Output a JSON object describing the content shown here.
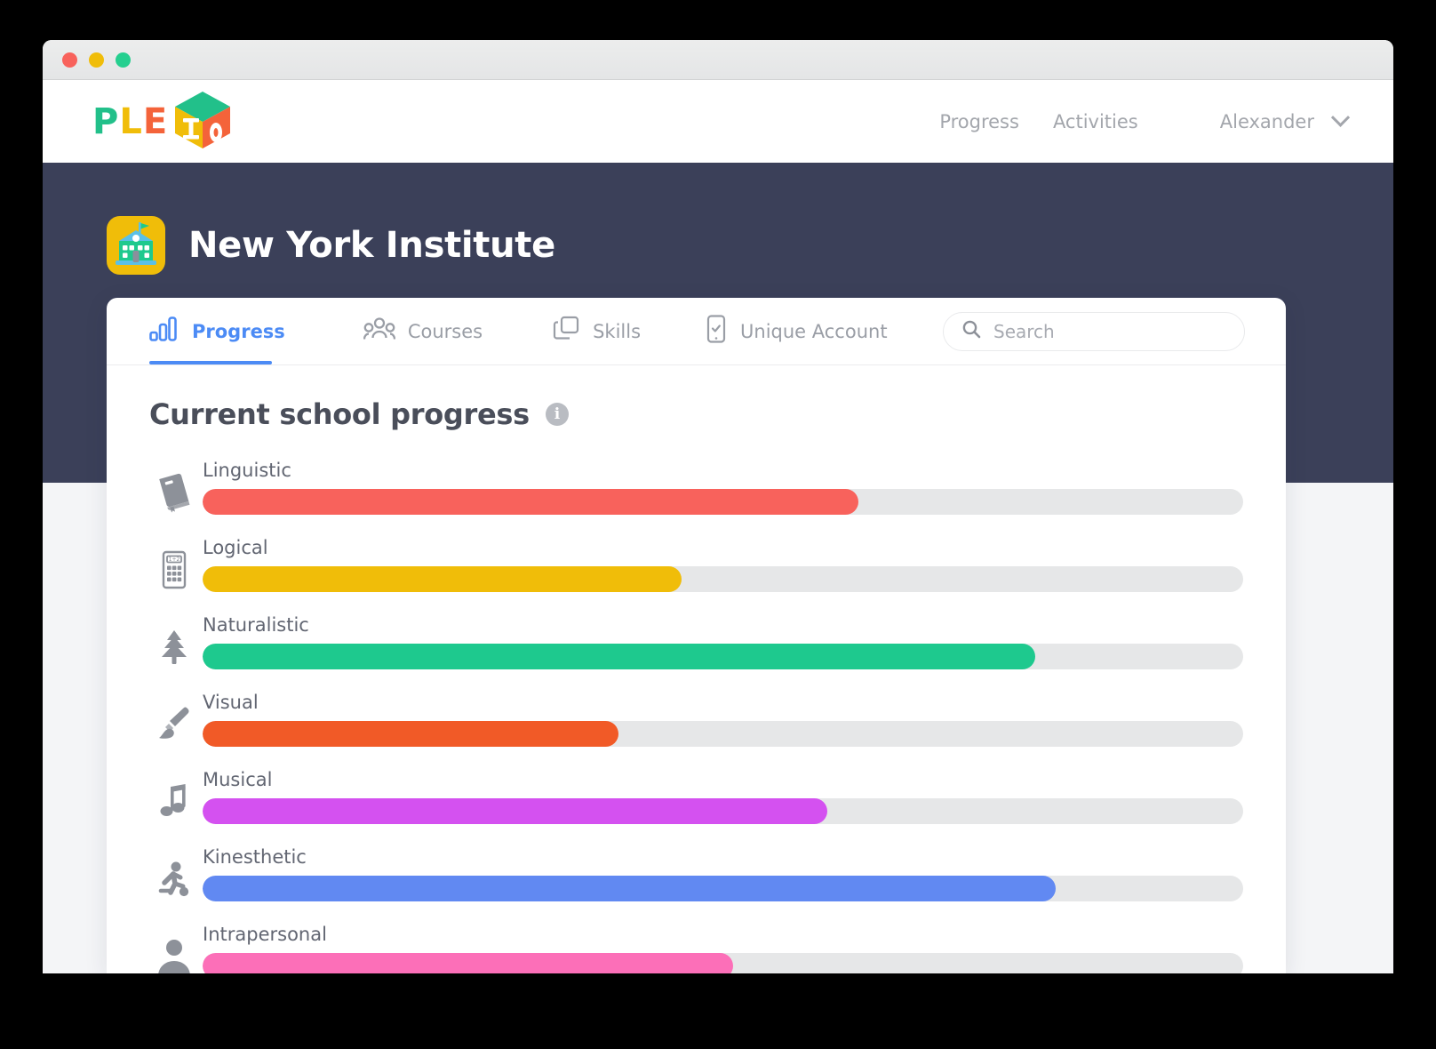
{
  "window": {
    "traffic_lights": [
      "close",
      "minimize",
      "maximize"
    ]
  },
  "brand": {
    "name": "PLEIO",
    "part1": "PLE",
    "part2": "I",
    "part3": "O",
    "colors": {
      "green": "#22c08a",
      "yellow": "#f0bd09",
      "orange": "#f4633a"
    }
  },
  "topnav": {
    "links": [
      {
        "label": "Progress",
        "name": "nav-link-progress"
      },
      {
        "label": "Activities",
        "name": "nav-link-activities"
      }
    ],
    "user": {
      "label": "Alexander",
      "caret": "chevron-down-icon"
    }
  },
  "header": {
    "icon": "school-icon",
    "title": "New York Institute"
  },
  "tabs": [
    {
      "label": "Progress",
      "icon": "bar-chart-icon",
      "active": true
    },
    {
      "label": "Courses",
      "icon": "people-group-icon",
      "active": false
    },
    {
      "label": "Skills",
      "icon": "layers-copy-icon",
      "active": false
    },
    {
      "label": "Unique Account",
      "icon": "mobile-check-icon",
      "active": false
    }
  ],
  "search": {
    "placeholder": "Search",
    "value": "",
    "icon": "search-icon"
  },
  "section": {
    "title": "Current school progress",
    "info_icon": "info-icon",
    "info_glyph": "i"
  },
  "chart_data": {
    "type": "bar",
    "orientation": "horizontal",
    "title": "Current school progress",
    "xlabel": "",
    "ylabel": "",
    "xlim": [
      0,
      100
    ],
    "grid": false,
    "legend": false,
    "categories": [
      "Linguistic",
      "Logical",
      "Naturalistic",
      "Visual",
      "Musical",
      "Kinesthetic",
      "Intrapersonal"
    ],
    "values": [
      63,
      46,
      80,
      40,
      60,
      82,
      51
    ],
    "colors": [
      "#f8625c",
      "#f0bd09",
      "#1ec98e",
      "#f15a27",
      "#d濃"
    ]
  },
  "progress": {
    "track_color": "#e6e7e8",
    "rows": [
      {
        "label": "Linguistic",
        "value": 63,
        "color": "#f8625c",
        "icon": "book-icon"
      },
      {
        "label": "Logical",
        "value": 46,
        "color": "#f0bd09",
        "icon": "calculator-icon"
      },
      {
        "label": "Naturalistic",
        "value": 80,
        "color": "#1ec98e",
        "icon": "tree-icon"
      },
      {
        "label": "Visual",
        "value": 40,
        "color": "#f15a27",
        "icon": "paintbrush-icon"
      },
      {
        "label": "Musical",
        "value": 60,
        "color": "#d451f0",
        "icon": "music-note-icon"
      },
      {
        "label": "Kinesthetic",
        "value": 82,
        "color": "#6189f2",
        "icon": "running-person-icon"
      },
      {
        "label": "Intrapersonal",
        "value": 51,
        "color": "#fc6fb8",
        "icon": "person-icon"
      }
    ]
  },
  "theme": {
    "band": "#3b4059",
    "accent": "#4c8bf5",
    "page_bg": "#f4f5f7"
  }
}
